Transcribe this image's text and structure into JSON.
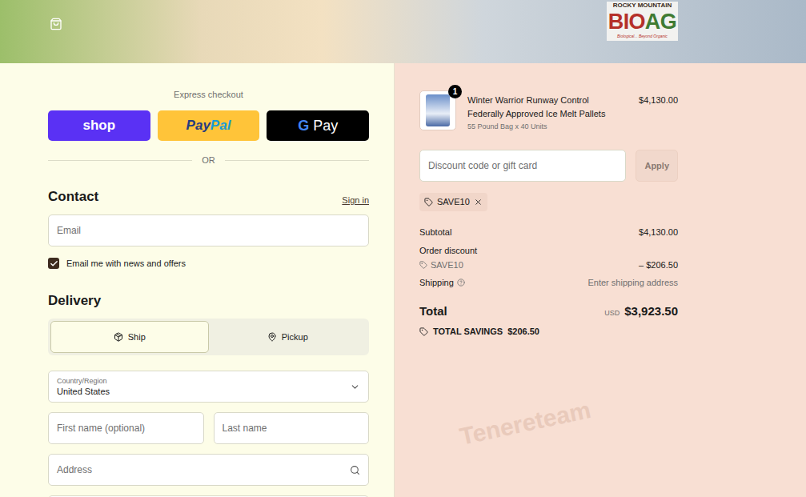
{
  "header": {
    "logo": {
      "top": "ROCKY MOUNTAIN",
      "mark": [
        "BIO",
        "AG"
      ],
      "tagline": "Biological... Beyond Organic"
    }
  },
  "watermark": "Tenereteam",
  "express_checkout": {
    "label": "Express checkout",
    "buttons": [
      {
        "name": "shop",
        "parts": [
          "shop"
        ]
      },
      {
        "name": "paypal",
        "parts": [
          "Pay",
          "Pal"
        ]
      },
      {
        "name": "gpay",
        "parts": [
          "G",
          "Pay"
        ]
      }
    ],
    "divider": "OR"
  },
  "contact": {
    "title": "Contact",
    "sign_in": "Sign in",
    "email": {
      "placeholder": "Email"
    },
    "newsletter": {
      "label": "Email me with news and offers",
      "checked": true
    }
  },
  "delivery": {
    "title": "Delivery",
    "options": [
      {
        "label": "Ship",
        "selected": true
      },
      {
        "label": "Pickup",
        "selected": false
      }
    ],
    "country": {
      "label": "Country/Region",
      "value": "United States"
    },
    "first_name": {
      "placeholder": "First name (optional)"
    },
    "last_name": {
      "placeholder": "Last name"
    },
    "address": {
      "placeholder": "Address"
    }
  },
  "cart": {
    "items": [
      {
        "title_lines": [
          "Winter Warrior Runway Control",
          "Federally Approved Ice Melt Pallets"
        ],
        "variant": "55 Pound Bag x 40 Units",
        "price": "$4,130.00",
        "quantity": "1"
      }
    ],
    "discount": {
      "placeholder": "Discount code or gift card",
      "button": "Apply",
      "applied": "SAVE10"
    },
    "summary": {
      "subtotal": {
        "label": "Subtotal",
        "value": "$4,130.00"
      },
      "order_discount": {
        "label": "Order discount",
        "code": "SAVE10",
        "value": "– $206.50"
      },
      "shipping": {
        "label": "Shipping",
        "value": "Enter shipping address"
      },
      "total": {
        "label": "Total",
        "currency": "USD",
        "value": "$3,923.50"
      },
      "savings": {
        "label": "TOTAL SAVINGS",
        "value": "$206.50"
      }
    }
  }
}
